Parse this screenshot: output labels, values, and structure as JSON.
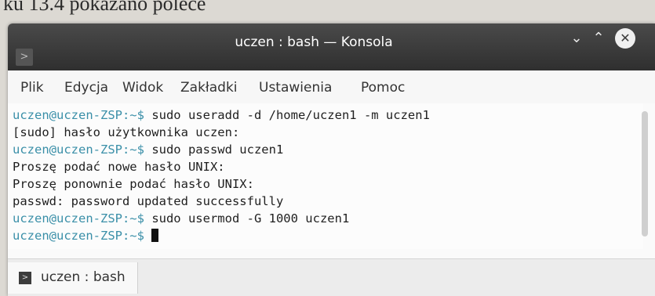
{
  "book": {
    "caption_fragment": "ku 13.4 pokazano polece"
  },
  "window": {
    "title": "uczen : bash — Konsola",
    "app_icon_glyph": ">",
    "minimize_glyph": "⌄",
    "maximize_glyph": "⌃",
    "close_glyph": "✕"
  },
  "menu": {
    "items": [
      "Plik",
      "Edycja",
      "Widok",
      "Zakładki",
      "Ustawienia",
      "Pomoc"
    ]
  },
  "terminal": {
    "prompt": "uczen@uczen-ZSP:~$",
    "lines": [
      {
        "prompt": "uczen@uczen-ZSP:~$",
        "text": " sudo useradd -d /home/uczen1 -m uczen1"
      },
      {
        "prompt": "",
        "text": "[sudo] hasło użytkownika uczen:"
      },
      {
        "prompt": "uczen@uczen-ZSP:~$",
        "text": " sudo passwd uczen1"
      },
      {
        "prompt": "",
        "text": "Proszę podać nowe hasło UNIX:"
      },
      {
        "prompt": "",
        "text": "Proszę ponownie podać hasło UNIX:"
      },
      {
        "prompt": "",
        "text": "passwd: password updated successfully"
      },
      {
        "prompt": "uczen@uczen-ZSP:~$",
        "text": " sudo usermod -G 1000 uczen1"
      },
      {
        "prompt": "uczen@uczen-ZSP:~$",
        "text": " "
      }
    ]
  },
  "tabs": [
    {
      "label": "uczen : bash",
      "icon": "terminal-icon"
    }
  ],
  "colors": {
    "titlebar": "#3a3a3a",
    "prompt": "#3a8fa8",
    "terminal_bg": "#fcfcfc"
  }
}
